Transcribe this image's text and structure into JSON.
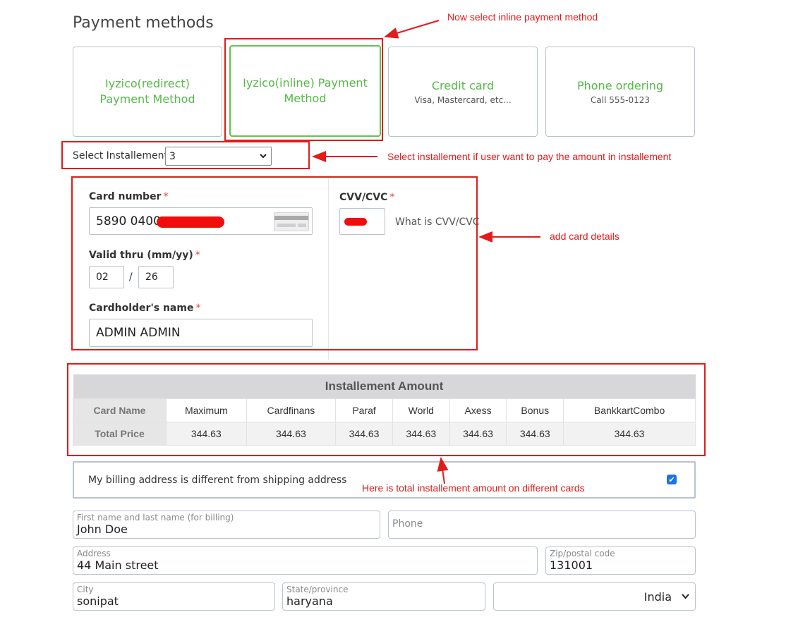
{
  "page_title": "Payment methods",
  "payment_methods": [
    {
      "title": "Iyzico(redirect) Payment Method",
      "subtitle": ""
    },
    {
      "title": "Iyzico(inline) Payment Method",
      "subtitle": ""
    },
    {
      "title": "Credit card",
      "subtitle": "Visa, Mastercard, etc..."
    },
    {
      "title": "Phone ordering",
      "subtitle": "Call 555-0123"
    }
  ],
  "installment": {
    "label": "Select Installement:",
    "value": "3"
  },
  "card_form": {
    "card_number_label": "Card number",
    "card_number_value": "5890 0400",
    "valid_thru_label": "Valid thru (mm/yy)",
    "month": "02",
    "year": "26",
    "separator": "/",
    "holder_label": "Cardholder's name",
    "holder_value": "ADMIN ADMIN",
    "cvv_label": "CVV/CVC",
    "cvv_help": "What is CVV/CVC",
    "required_mark": "*"
  },
  "installment_table": {
    "title": "Installement Amount",
    "row1_head": "Card Name",
    "row2_head": "Total Price",
    "cards": [
      "Maximum",
      "Cardfinans",
      "Paraf",
      "World",
      "Axess",
      "Bonus",
      "BankkartCombo"
    ],
    "prices": [
      "344.63",
      "344.63",
      "344.63",
      "344.63",
      "344.63",
      "344.63",
      "344.63"
    ]
  },
  "billing": {
    "text": "My billing address is different from shipping address",
    "checked": true
  },
  "address_form": {
    "name_label": "First name and last name (for billing)",
    "name_value": "John Doe",
    "phone_placeholder": "Phone",
    "address_label": "Address",
    "address_value": "44 Main street",
    "zip_label": "Zip/postal code",
    "zip_value": "131001",
    "city_label": "City",
    "city_value": "sonipat",
    "state_label": "State/province",
    "state_value": "haryana",
    "country_value": "India"
  },
  "annotations": {
    "select_inline": "Now select inline payment method",
    "select_installment": "Select installement if user want to pay the amount in installement",
    "add_card": "add card details",
    "total_amount": "Here is total installement amount on different cards"
  },
  "colors": {
    "annotation": "#e21b1b",
    "method_text": "#55b948",
    "selected_border": "#66c24f"
  }
}
